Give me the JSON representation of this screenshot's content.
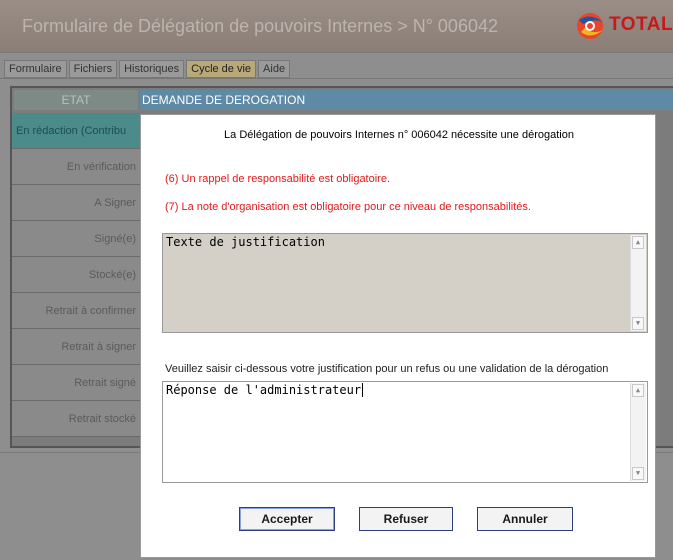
{
  "header": {
    "title": "Formulaire de Délégation de pouvoirs Internes > N° 006042",
    "logo_text": "TOTAL"
  },
  "tabs": [
    {
      "label": "Formulaire"
    },
    {
      "label": "Fichiers"
    },
    {
      "label": "Historiques"
    },
    {
      "label": "Cycle de vie",
      "active": true
    },
    {
      "label": "Aide"
    }
  ],
  "table": {
    "header_etat": "ETAT",
    "header_demande": "DEMANDE DE DEROGATION",
    "states": [
      "En rédaction (Contribu",
      "En vérification",
      "A Signer",
      "Signé(e)",
      "Stocké(e)",
      "Retrait à confirmer",
      "Retrait à signer",
      "Retrait signé",
      "Retrait stocké"
    ]
  },
  "dialog": {
    "title": "La Délégation de pouvoirs Internes n° 006042 nécessite une dérogation",
    "errors": [
      "(6) Un rappel de responsabilité est obligatoire.",
      "(7) La note d'organisation est obligatoire pour ce niveau de responsabilités."
    ],
    "justification_text": "Texte de justification",
    "instruction": "Veuillez saisir ci-dessous votre justification pour un refus ou une validation de la dérogation",
    "response_text": "Réponse de l'administrateur",
    "buttons": {
      "accept": "Accepter",
      "refuse": "Refuser",
      "cancel": "Annuler"
    }
  },
  "colors": {
    "error": "#e01a1a",
    "header_demande": "#5f8aa6",
    "current_state": "#4b8c8a",
    "logo": "#c51a1a"
  }
}
